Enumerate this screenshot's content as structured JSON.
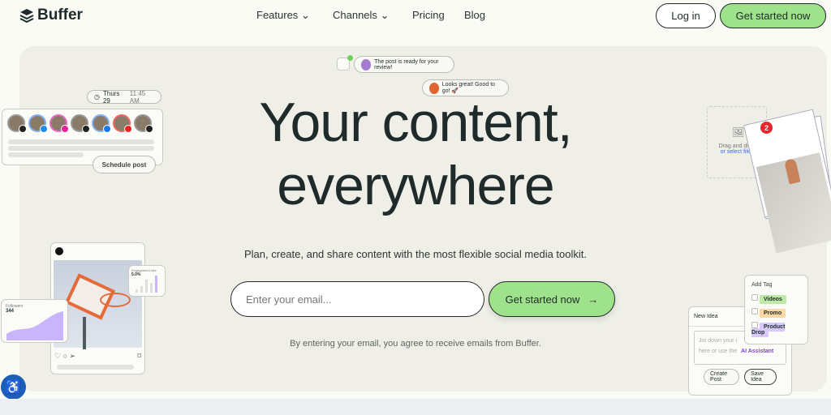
{
  "nav": {
    "brand": "Buffer",
    "features": "Features",
    "channels": "Channels",
    "pricing": "Pricing",
    "blog": "Blog",
    "login": "Log in",
    "get_started": "Get started now"
  },
  "hero": {
    "headline_line1": "Your content,",
    "headline_line2": "everywhere",
    "subtitle": "Plan, create, and share content with the most flexible social media toolkit.",
    "email_placeholder": "Enter your email...",
    "cta": "Get started now",
    "legal": "By entering your email, you agree to receive emails from Buffer."
  },
  "decor": {
    "chat1": "The post is ready for your review!",
    "chat2": "Looks great! Good to go! 🚀",
    "date": "Thurs 29",
    "time": "11:45 AM",
    "schedule": "Schedule post",
    "followers_label": "Followers",
    "followers_value": "344",
    "engagement_label": "Engagement rate",
    "engagement_value": "5.0%",
    "drag_text": "Drag and drop",
    "select_files": "or select files",
    "badge_count": "2",
    "new_idea": "New Idea",
    "idea_placeholder_1": "Jot down your i",
    "idea_placeholder_2": "here or use the",
    "ai_assistant": "AI Assistant",
    "create_post": "Create Post",
    "save_idea": "Save Idea",
    "add_tag": "Add Tag",
    "tags": [
      "Videos",
      "Promo",
      "Product Drop"
    ]
  },
  "colors": {
    "accent_green": "#9fe28c",
    "hero_bg": "#efefe8",
    "text_dark": "#1f2b2a",
    "purple": "#c9b5fb"
  }
}
